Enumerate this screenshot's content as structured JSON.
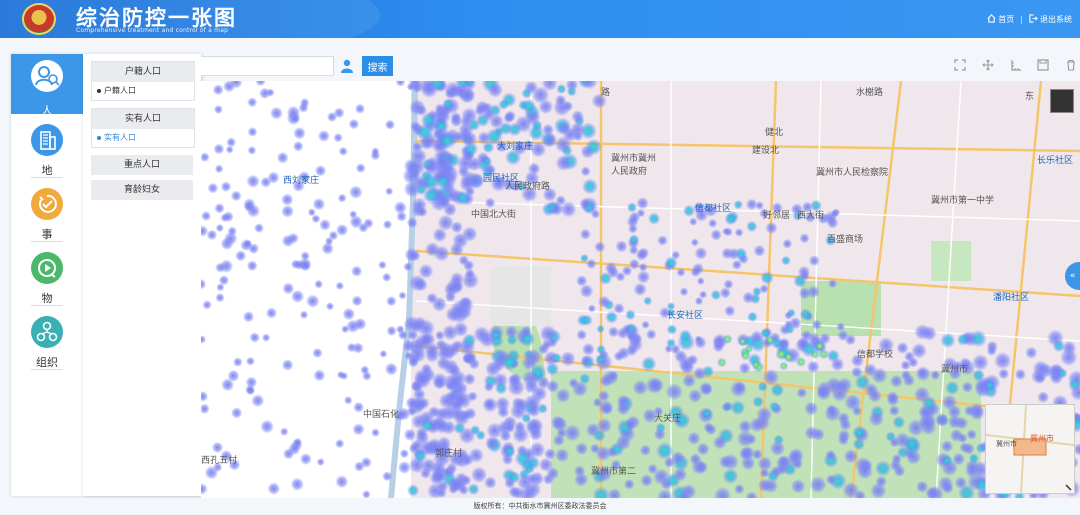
{
  "header": {
    "title": "综治防控一张图",
    "subtitle": "Comprehensive treatment and control of a map",
    "home_label": "首页",
    "separator": "|",
    "logout_label": "退出系统"
  },
  "sidebar": {
    "categories": [
      {
        "label": "人",
        "icon": "people-icon"
      },
      {
        "label": "地",
        "icon": "building-icon"
      },
      {
        "label": "事",
        "icon": "event-icon"
      },
      {
        "label": "物",
        "icon": "camera-icon"
      },
      {
        "label": "组织",
        "icon": "organization-icon"
      }
    ]
  },
  "submenu": {
    "groups": [
      {
        "label": "户籍人口",
        "items": [
          "户籍人口"
        ]
      },
      {
        "label": "实有人口",
        "items": [
          "实有人口"
        ]
      },
      {
        "label": "重点人口",
        "items": []
      },
      {
        "label": "育龄妇女",
        "items": []
      }
    ]
  },
  "search": {
    "value": "",
    "button_label": "搜索"
  },
  "map": {
    "labels": [
      "西刘家庄",
      "大刘家庄",
      "园民社区",
      "中国北大街",
      "信都社区",
      "冀州市冀州",
      "人民政府",
      "冀州市人民检察院",
      "长乐社区",
      "长安社区",
      "潘阳社区",
      "大关庄",
      "郭庄村",
      "西孔五村",
      "中国石化",
      "冀州市第二",
      "冀州市",
      "信都学校",
      "水榭路",
      "健北",
      "路",
      "建设北",
      "东",
      "冀州市第一中学",
      "好邻居",
      "百盛商场",
      "西大街",
      "人民政府路"
    ],
    "overview_labels": [
      "冀州市",
      "冀州市"
    ]
  },
  "footer": {
    "copyright": "版权所有：中共衡水市冀州区委政法委员会"
  },
  "colors": {
    "header_blue": "#2e8ff0",
    "active_blue": "#3d97e8",
    "heat_low": "#6f78f0",
    "heat_mid": "#32d7c4",
    "heat_high": "#e8ec3a"
  }
}
